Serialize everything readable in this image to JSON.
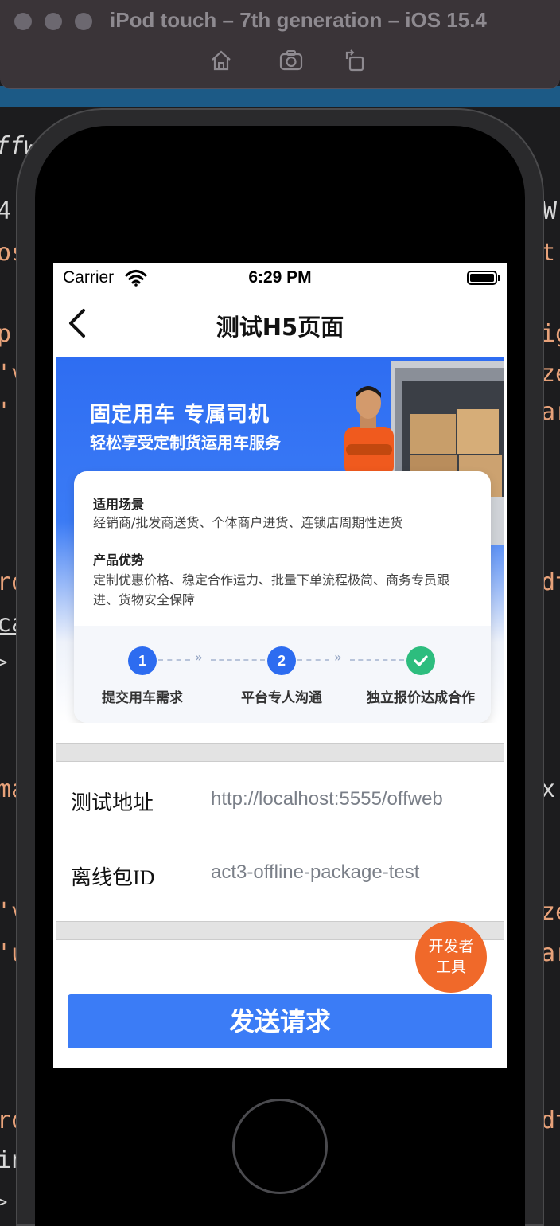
{
  "simulator": {
    "title": "iPod touch – 7th generation – iOS 15.4"
  },
  "status_bar": {
    "carrier": "Carrier",
    "time": "6:29 PM"
  },
  "nav": {
    "title": "测试H5页面"
  },
  "banner": {
    "headline": "固定用车 专属司机",
    "subheadline": "轻松享受定制货运用车服务"
  },
  "info_card": {
    "scenario_title": "适用场景",
    "scenario_text": "经销商/批发商送货、个体商户进货、连锁店周期性进货",
    "advantage_title": "产品优势",
    "advantage_text": "定制优惠价格、稳定合作运力、批量下单流程极简、商务专员跟进、货物安全保障",
    "steps": [
      {
        "number": "1",
        "label": "提交用车需求"
      },
      {
        "number": "2",
        "label": "平台专人沟通"
      },
      {
        "number": "",
        "label": "独立报价达成合作"
      }
    ],
    "arrow": "»"
  },
  "form": {
    "url_label": "测试地址",
    "url_value": "http://localhost:5555/offweb",
    "package_label": "离线包ID",
    "package_value": "act3-offline-package-test"
  },
  "dev_tools_label_line1": "开发者",
  "dev_tools_label_line2": "工具",
  "send_button": "发送请求",
  "background_code": [
    "ffw",
    "4",
    "os",
    "p:",
    "'v",
    "'",
    "ro",
    "ca",
    ">",
    "ma",
    "'v",
    "'u",
    "ro",
    "in",
    ">",
    "W",
    "t",
    "ig",
    "ze",
    "ar",
    "dt",
    "x,",
    "ze",
    "ar",
    "dt"
  ],
  "colors": {
    "primary_blue": "#3b7cf6",
    "dev_tools_orange": "#f0692a",
    "done_green": "#2dbd7e"
  }
}
